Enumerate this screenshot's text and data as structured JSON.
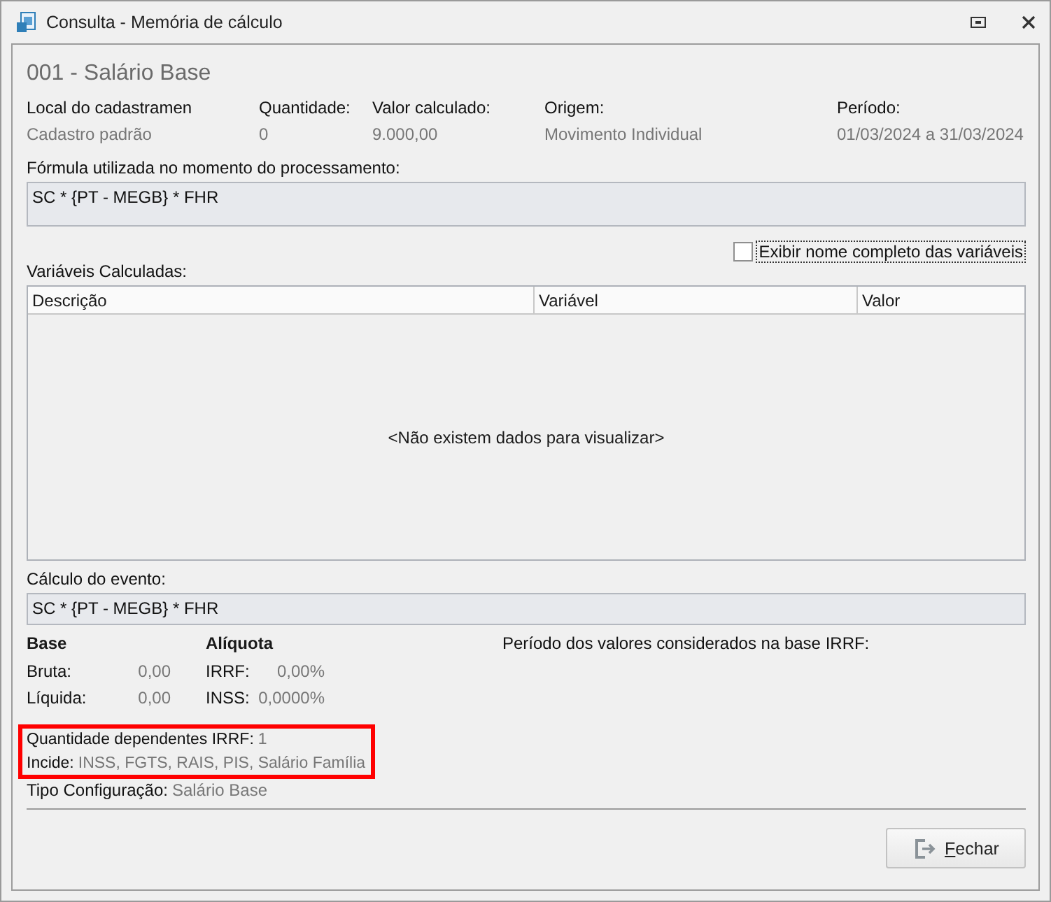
{
  "window": {
    "title": "Consulta - Memória de cálculo"
  },
  "event_title": "001 - Salário Base",
  "summary": [
    {
      "label": "Local do cadastramen",
      "value": "Cadastro padrão"
    },
    {
      "label": "Quantidade:",
      "value": "0"
    },
    {
      "label": "Valor calculado:",
      "value": "9.000,00"
    },
    {
      "label": "Origem:",
      "value": "Movimento Individual"
    },
    {
      "label": "Período:",
      "value": "01/03/2024 a 31/03/2024"
    }
  ],
  "formula": {
    "label": "Fórmula utilizada no momento do processamento:",
    "value": "SC * {PT - MEGB} * FHR"
  },
  "show_full_names": {
    "label": "Exibir nome completo das variáveis",
    "checked": false
  },
  "variables": {
    "label": "Variáveis Calculadas:",
    "columns": [
      "Descrição",
      "Variável",
      "Valor"
    ],
    "empty_message": "<Não existem dados para visualizar>"
  },
  "event_calculation": {
    "label": "Cálculo do evento:",
    "value": "SC * {PT - MEGB} * FHR"
  },
  "base": {
    "heading": "Base",
    "rows": [
      {
        "label": "Bruta:",
        "value": "0,00"
      },
      {
        "label": "Líquida:",
        "value": "0,00"
      }
    ]
  },
  "rate": {
    "heading": "Alíquota",
    "rows": [
      {
        "label": "IRRF:",
        "value": "0,00%"
      },
      {
        "label": "INSS:",
        "value": "0,0000%"
      }
    ]
  },
  "irrf_period": {
    "label": "Período dos valores considerados na base IRRF:"
  },
  "details": [
    {
      "label": "Quantidade dependentes IRRF:",
      "value": "1",
      "highlighted": true
    },
    {
      "label": "Incide:",
      "value": "INSS, FGTS, RAIS, PIS, Salário Família",
      "highlighted": true
    },
    {
      "label": "Tipo Configuração:",
      "value": "Salário Base",
      "highlighted": false
    }
  ],
  "buttons": [
    {
      "label": "Fechar"
    }
  ]
}
